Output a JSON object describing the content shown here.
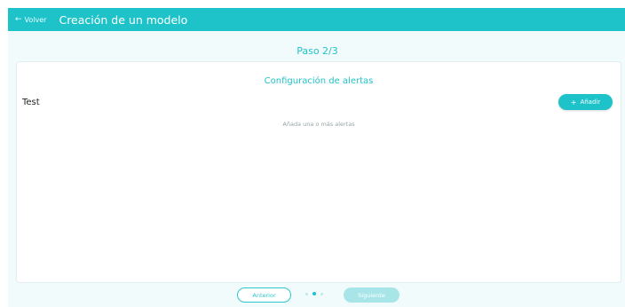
{
  "header": {
    "back_icon": "arrow-left-icon",
    "back_label": "Volver",
    "title": "Creación de un modelo"
  },
  "wizard": {
    "step_label": "Paso 2/3",
    "current_step": 2,
    "total_steps": 3
  },
  "alerts_card": {
    "title": "Configuración de alertas",
    "model_name": "Test",
    "add_button_icon": "plus-icon",
    "add_button_label": "Añadir",
    "empty_message": "Añada una o más alertas"
  },
  "footer": {
    "prev_label": "Anterior",
    "next_label": "Siguiente",
    "next_enabled": false
  },
  "colors": {
    "accent": "#1ec3c9",
    "background": "#f2fbfc",
    "disabled_button": "#a8e5e8"
  }
}
